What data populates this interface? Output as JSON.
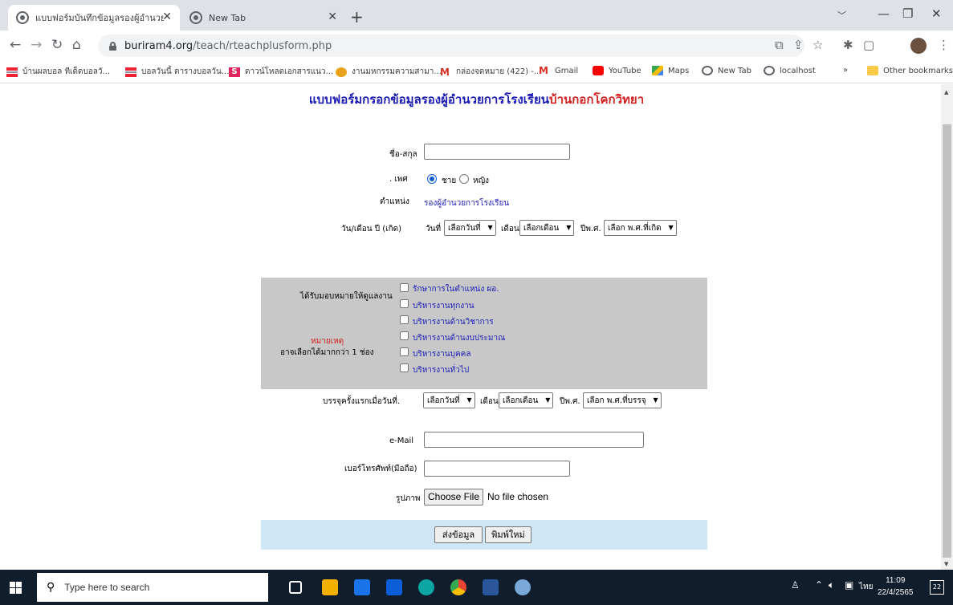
{
  "browser": {
    "tabs": [
      {
        "title": "แบบฟอร์มบันทึกข้อมูลรองผู้อำนวยการโ",
        "active": true
      },
      {
        "title": "New Tab",
        "active": false
      }
    ],
    "url_host": "buriram4.org",
    "url_path": "/teach/rteachplusform.php",
    "bookmarks": [
      {
        "label": "บ้านผลบอล ทีเด็ดบอลวั...",
        "icon": "thai-flag-icon"
      },
      {
        "label": "บอลวันนี้ ตารางบอลวัน...",
        "icon": "thai-flag-icon"
      },
      {
        "label": "ดาวน์โหลดเอกสารแนว...",
        "icon": "s-logo-icon"
      },
      {
        "label": "งานมหกรรมความสามา...",
        "icon": "drop-icon"
      },
      {
        "label": "กล่องจดหมาย (422) -...",
        "icon": "gmail-icon"
      },
      {
        "label": "Gmail",
        "icon": "gmail-icon"
      },
      {
        "label": "YouTube",
        "icon": "youtube-icon"
      },
      {
        "label": "Maps",
        "icon": "maps-icon"
      },
      {
        "label": "New Tab",
        "icon": "globe-icon"
      },
      {
        "label": "localhost",
        "icon": "globe-icon"
      }
    ],
    "overflow_label": "»",
    "other_bookmarks": "Other bookmarks"
  },
  "form": {
    "title_main": "แบบฟอร์มกรอกข้อมูลรองผู้อำนวยการโรงเรียน",
    "title_school": "บ้านกอกโคกวิทยา",
    "name_label": "ชื่อ-สกุล",
    "name_value": "",
    "gender_label": ". เพศ",
    "gender_options": [
      "ชาย",
      "หญิง"
    ],
    "gender_selected": "ชาย",
    "position_label": "ตำแหน่ง",
    "position_value": "รองผู้อำนวยการโรงเรียน",
    "birth_label": "วัน/เดือน ปี (เกิด)",
    "day_label": "วันที่",
    "day_select": "เลือกวันที่",
    "month_label": "เดือน",
    "month_select": "เลือกเดือน",
    "year_label": "ปีพ.ศ.",
    "birth_year_select": "เลือก พ.ศ.ที่เกิด",
    "duty_label": "ได้รับมอบหมายให้ดูแลงาน",
    "note_label": "หมายเหตุ",
    "note_text": "อาจเลือกได้มากกว่า  1 ช่อง",
    "duties": [
      "รักษาการในตำแหน่ง ผอ.",
      "บริหารงานทุกงาน",
      "บริหารงานด้านวิชาการ",
      "บริหารงานด้านงบประมาณ",
      "บริหารงานบุคคล",
      "บริหารงานทั่วไป"
    ],
    "appoint_label": "บรรจุครั้งแรกเมื่อวันที่.",
    "appoint_year_select": "เลือก พ.ศ.ที่บรรจุ",
    "email_label": "e-Mail",
    "email_value": "",
    "phone_label": "เบอร์โทรศัพท์(มือถือ)",
    "phone_value": "",
    "photo_label": "รูปภาพ",
    "choose_file": "Choose File",
    "no_file": "No file chosen",
    "submit": "ส่งข้อมูล",
    "reset": "พิมพ์ใหม่"
  },
  "taskbar": {
    "search_placeholder": "Type here to search",
    "lang": "ไทย",
    "time": "11:09",
    "date": "22/4/2565",
    "notifications": "22"
  }
}
